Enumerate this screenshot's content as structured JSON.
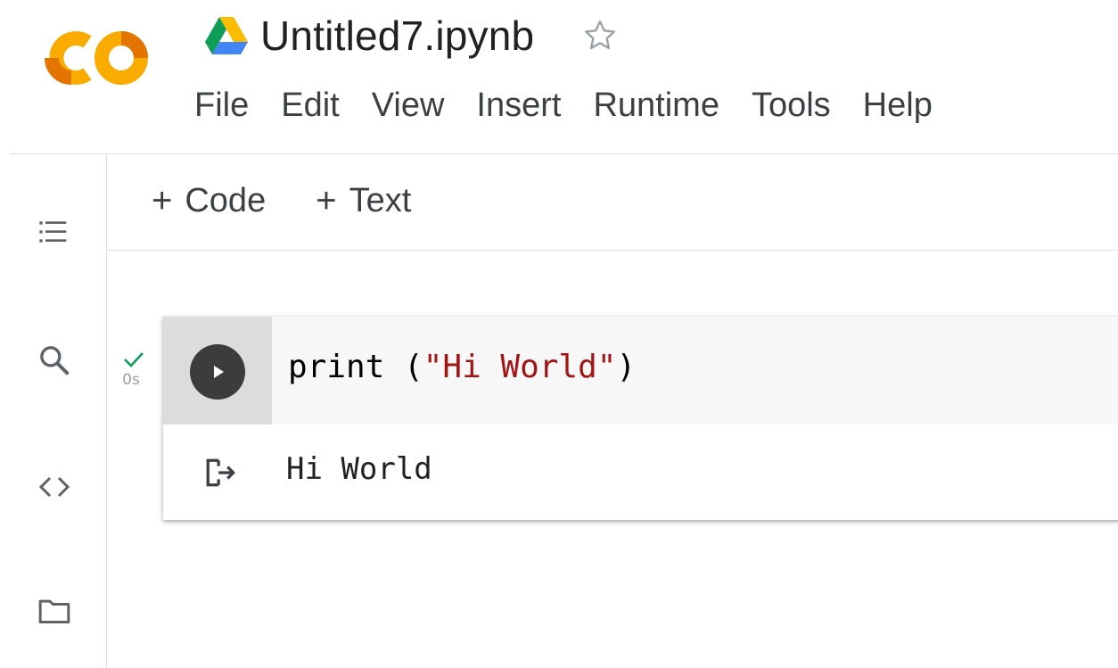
{
  "header": {
    "logo_text": "CO",
    "notebook_title": "Untitled7.ipynb",
    "drive_icon": "google-drive-icon",
    "star_icon": "star-outline-icon"
  },
  "menu": {
    "items": [
      {
        "label": "File"
      },
      {
        "label": "Edit"
      },
      {
        "label": "View"
      },
      {
        "label": "Insert"
      },
      {
        "label": "Runtime"
      },
      {
        "label": "Tools"
      },
      {
        "label": "Help"
      }
    ]
  },
  "sidebar": {
    "icons": [
      "table-of-contents-icon",
      "search-icon",
      "code-snippets-icon",
      "folder-icon"
    ]
  },
  "toolbar": {
    "add_code_label": "Code",
    "add_text_label": "Text",
    "plus_symbol": "+"
  },
  "cell": {
    "status": "success",
    "exec_time": "0s",
    "code_prefix": "print (",
    "code_string": "\"Hi World\"",
    "code_suffix": ")",
    "output": "Hi World"
  },
  "colors": {
    "logo_orange": "#f9ab00",
    "logo_dark_orange": "#e37400",
    "check_green": "#0f9d58",
    "string_red": "#a31515",
    "run_button": "#3c3c3c"
  }
}
